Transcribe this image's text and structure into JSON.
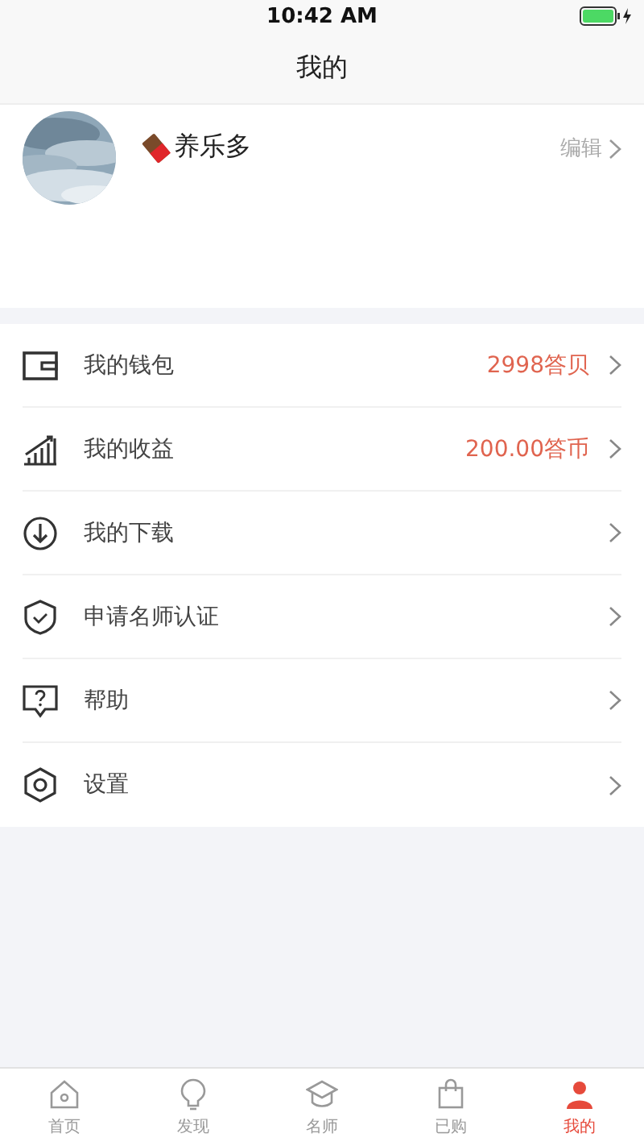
{
  "status_bar": {
    "time": "10:42 AM"
  },
  "nav": {
    "title": "我的"
  },
  "profile": {
    "name": "养乐多",
    "edit": "编辑"
  },
  "menu": [
    {
      "label": "我的钱包",
      "value": "2998答贝"
    },
    {
      "label": "我的收益",
      "value": "200.00答币"
    },
    {
      "label": "我的下载"
    },
    {
      "label": "申请名师认证"
    },
    {
      "label": "帮助"
    },
    {
      "label": "设置"
    }
  ],
  "tab_bar": [
    {
      "label": "首页",
      "selected": false
    },
    {
      "label": "发现",
      "selected": false
    },
    {
      "label": "名师",
      "selected": false
    },
    {
      "label": "已购",
      "selected": false
    },
    {
      "label": "我的",
      "selected": true
    }
  ]
}
